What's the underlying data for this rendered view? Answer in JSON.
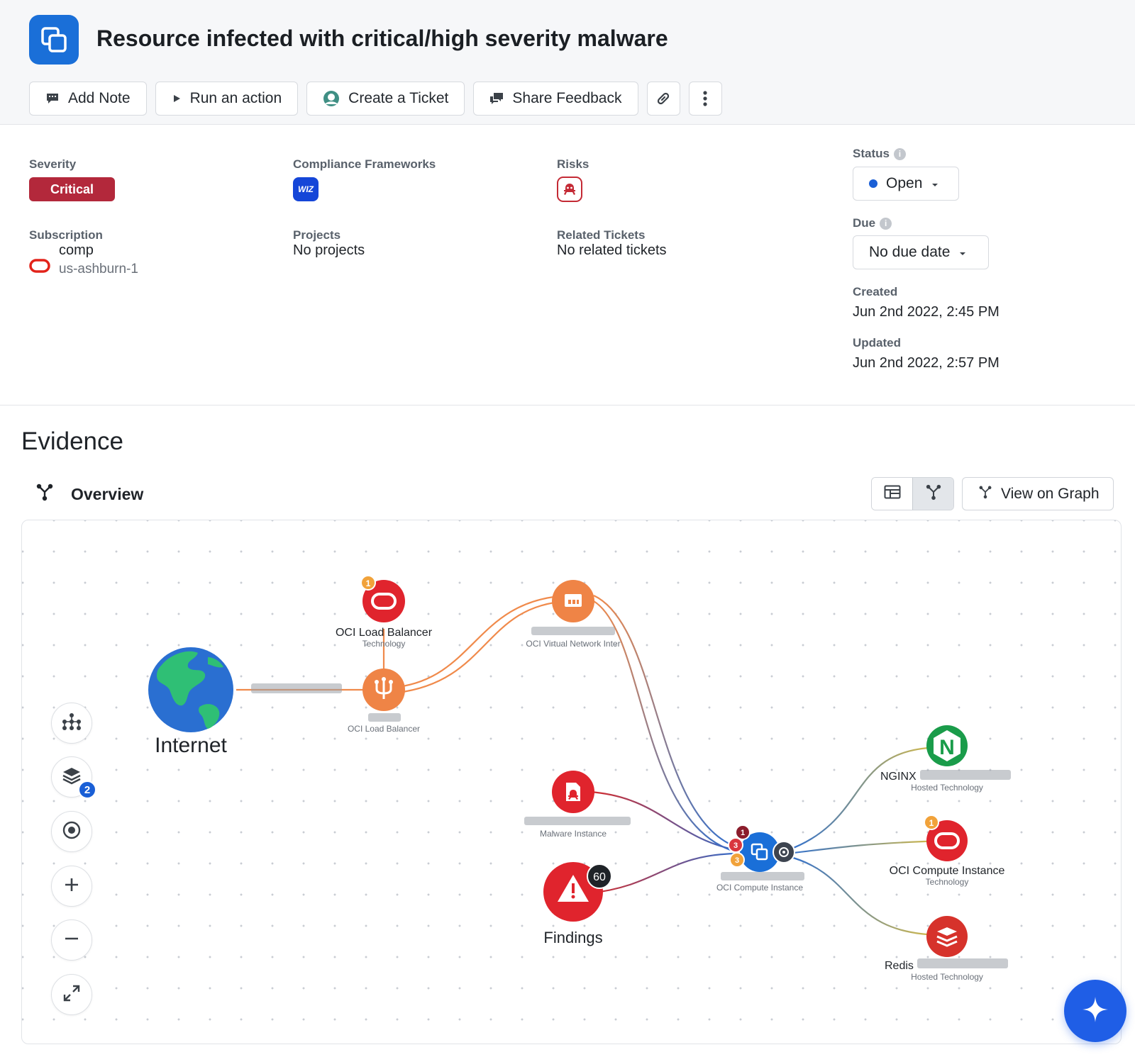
{
  "header": {
    "title": "Resource infected with critical/high severity malware",
    "actions": {
      "add_note": "Add Note",
      "run_action": "Run an action",
      "create_ticket": "Create a Ticket",
      "share_feedback": "Share Feedback"
    }
  },
  "details": {
    "severity": {
      "label": "Severity",
      "value": "Critical",
      "color": "#b3283b"
    },
    "compliance": {
      "label": "Compliance Frameworks",
      "badge": "WIZ"
    },
    "risks": {
      "label": "Risks",
      "icon": "malware-icon"
    },
    "status": {
      "label": "Status",
      "value": "Open",
      "dot_color": "#1a5fd6"
    },
    "subscription": {
      "label": "Subscription",
      "name": "comp",
      "region": "us-ashburn-1"
    },
    "projects": {
      "label": "Projects",
      "value": "No projects"
    },
    "related_tickets": {
      "label": "Related Tickets",
      "value": "No related tickets"
    },
    "due": {
      "label": "Due",
      "value": "No due date"
    },
    "created": {
      "label": "Created",
      "value": "Jun 2nd 2022, 2:45 PM"
    },
    "updated": {
      "label": "Updated",
      "value": "Jun 2nd 2022, 2:57 PM"
    }
  },
  "evidence": {
    "title": "Evidence",
    "overview_label": "Overview",
    "view_on_graph": "View on Graph",
    "layers_count": "2",
    "graph": {
      "internet": {
        "label": "Internet"
      },
      "lb_technology": {
        "label": "OCI Load Balancer",
        "sublabel": "Technology",
        "badge": "1"
      },
      "lb": {
        "sublabel": "OCI Load Balancer"
      },
      "vnic": {
        "sublabel": "OCI Virtual Network Inter"
      },
      "malware": {
        "sublabel": "Malware Instance"
      },
      "findings": {
        "label": "Findings",
        "count": "60"
      },
      "compute": {
        "sublabel": "OCI Compute Instance",
        "badge_top": "1",
        "badge_mid": "3",
        "badge_bottom": "3"
      },
      "nginx": {
        "label": "NGINX",
        "sublabel": "Hosted Technology",
        "glyph": "N"
      },
      "compute_tech": {
        "label": "OCI Compute Instance",
        "sublabel": "Technology",
        "badge": "1"
      },
      "redis": {
        "label": "Redis",
        "sublabel": "Hosted Technology"
      }
    }
  }
}
